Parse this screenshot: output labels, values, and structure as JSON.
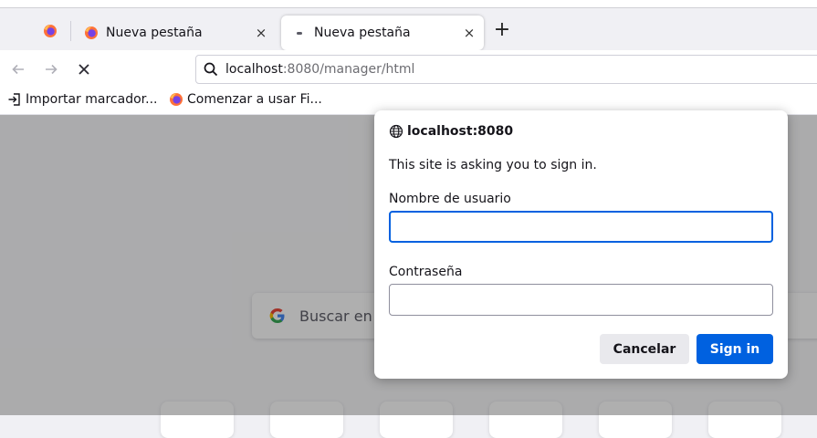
{
  "tabs": [
    {
      "title": "Nueva pestaña",
      "close": "×"
    },
    {
      "title": "Nueva pestaña",
      "close": "×"
    }
  ],
  "new_tab_label": "+",
  "urlbar": {
    "host": "localhost",
    "rest": ":8080/manager/html"
  },
  "bookmarks": [
    {
      "label": "Importar marcador..."
    },
    {
      "label": "Comenzar a usar Fi..."
    }
  ],
  "newtab_page": {
    "search_placeholder": "Buscar en"
  },
  "dialog": {
    "origin": "localhost:8080",
    "message": "This site is asking you to sign in.",
    "username_label": "Nombre de usuario",
    "username_value": "",
    "password_label": "Contraseña",
    "password_value": "",
    "cancel_label": "Cancelar",
    "signin_label": "Sign in"
  },
  "colors": {
    "accent": "#0061e0",
    "chrome_bg": "#f0f0f4",
    "overlay": "rgba(12,12,13,0.33)"
  }
}
